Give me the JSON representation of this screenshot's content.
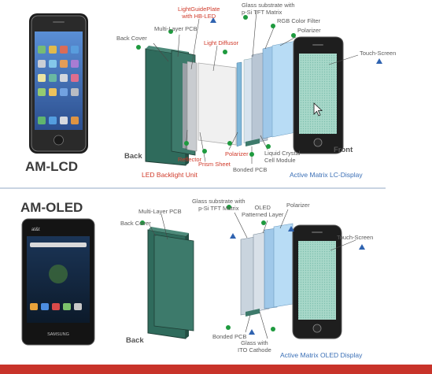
{
  "lcd": {
    "title": "AM-LCD",
    "back_label": "Back",
    "front_label": "Front",
    "labels": {
      "back_cover": "Back Cover",
      "multi_layer_pcb": "Multi-Layer PCB",
      "light_guide_plate": "LightGuidePlate\nwith HB-LED",
      "light_diffusor": "Light Diffusor",
      "glass_substrate": "Glass substrate with\np-Si TFT Matrix",
      "rgb_color_filter": "RGB Color Filter",
      "polarizer_top": "Polarizer",
      "touch_screen": "Touch-Screen",
      "reflector": "Reflector",
      "prism_sheet": "Prism Sheet",
      "polarizer_bottom": "Polarizer",
      "bonded_pcb": "Bonded PCB",
      "liquid_crystal": "Liquid Crystal\nCell Module"
    },
    "led_backlight_unit": "LED Backlight Unit",
    "active_matrix_label": "Active Matrix LC-Display"
  },
  "oled": {
    "title": "AM-OLED",
    "back_label": "Back",
    "labels": {
      "multi_layer_pcb": "Multi-Layer PCB",
      "back_cover": "Back Cover",
      "glass_substrate": "Glass substrate with\np-Si TFT Matrix",
      "oled_layer": "OLED\nPatterned Layer",
      "polarizer": "Polarizer",
      "touch_screen": "Touch-Screen",
      "bonded_pcb": "Bonded PCB",
      "glass_ito": "Glass with\nITO Cathode"
    },
    "active_matrix_label": "Active Matrix OLED Display"
  },
  "phone_brand": "SAMSUNG",
  "colors": {
    "accent_red": "#c8332a",
    "label_blue": "#3a6fb6",
    "label_red": "#d03a2a",
    "pcb_teal": "#2f6b5c",
    "marker_green": "#1e9a3e",
    "marker_blue": "#2f63b0"
  }
}
